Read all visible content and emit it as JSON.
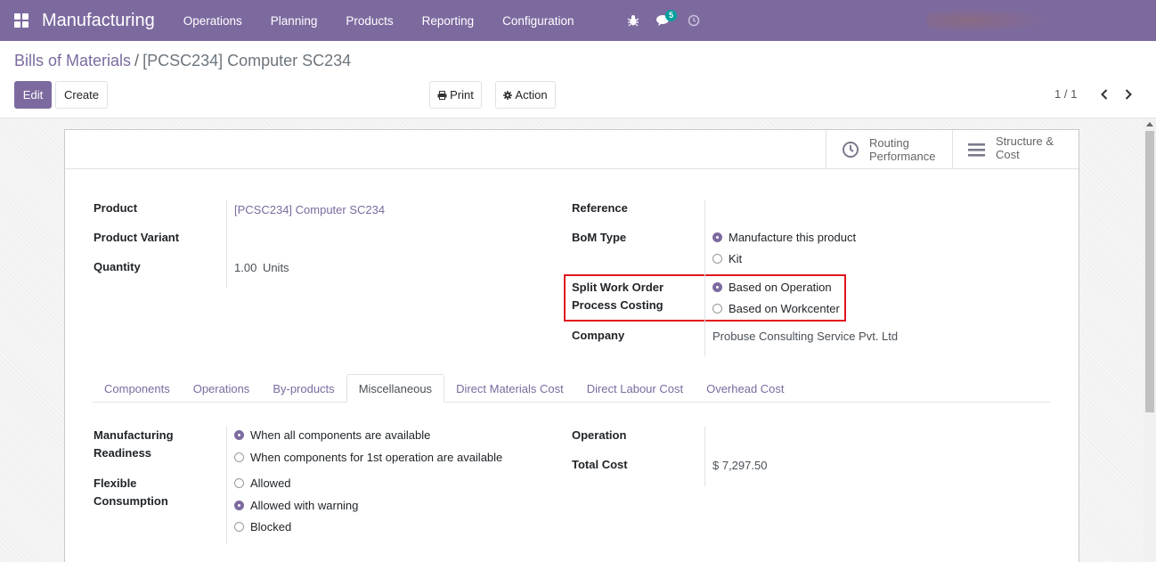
{
  "app": {
    "title": "Manufacturing"
  },
  "menu": [
    "Operations",
    "Planning",
    "Products",
    "Reporting",
    "Configuration"
  ],
  "systray": {
    "messages_count": "5"
  },
  "breadcrumb": {
    "parent": "Bills of Materials",
    "separator": "/",
    "current": "[PCSC234] Computer SC234"
  },
  "buttons": {
    "edit": "Edit",
    "create": "Create",
    "print": "Print",
    "action": "Action"
  },
  "pager": {
    "value": "1 / 1"
  },
  "stat_buttons": [
    {
      "line1": "Routing",
      "line2": "Performance",
      "icon": "clock-icon"
    },
    {
      "line1": "Structure &",
      "line2": "Cost",
      "icon": "bars-icon"
    }
  ],
  "form": {
    "product_label": "Product",
    "product_value": "[PCSC234] Computer SC234",
    "variant_label": "Product Variant",
    "quantity_label": "Quantity",
    "quantity_value": "1.00",
    "quantity_uom": "Units",
    "reference_label": "Reference",
    "bom_type_label": "BoM Type",
    "bom_type_options": [
      "Manufacture this product",
      "Kit"
    ],
    "split_label_1": "Split Work Order",
    "split_label_2": "Process Costing",
    "split_options": [
      "Based on Operation",
      "Based on Workcenter"
    ],
    "company_label": "Company",
    "company_value": "Probuse Consulting Service Pvt. Ltd"
  },
  "tabs": [
    "Components",
    "Operations",
    "By-products",
    "Miscellaneous",
    "Direct Materials Cost",
    "Direct Labour Cost",
    "Overhead Cost"
  ],
  "misc": {
    "readiness_label_1": "Manufacturing",
    "readiness_label_2": "Readiness",
    "readiness_options": [
      "When all components are available",
      "When components for 1st operation are available"
    ],
    "flexible_label_1": "Flexible",
    "flexible_label_2": "Consumption",
    "flexible_options": [
      "Allowed",
      "Allowed with warning",
      "Blocked"
    ],
    "operation_label": "Operation",
    "total_cost_label": "Total Cost",
    "total_cost_value": "$ 7,297.50"
  },
  "colors": {
    "brand": "#7c6a9f",
    "highlight": "#e0141e",
    "badge": "#00a09d"
  }
}
